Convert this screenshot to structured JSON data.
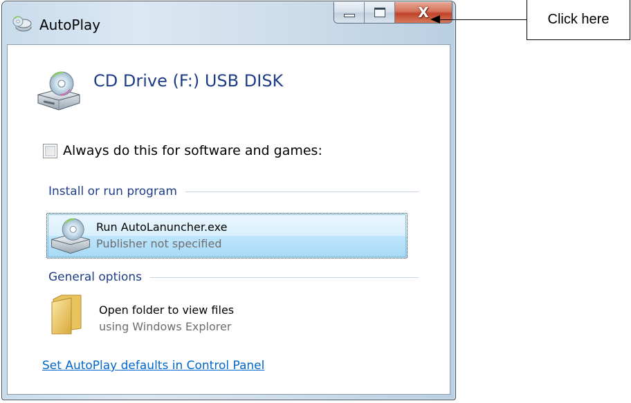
{
  "window": {
    "title": "AutoPlay",
    "caption": {
      "minimize_icon": "minimize-icon",
      "maximize_icon": "maximize-icon",
      "close_glyph": "X"
    }
  },
  "device": {
    "title": "CD Drive (F:) USB DISK",
    "icon": "cd-drive-icon"
  },
  "always_checkbox": {
    "label": "Always do this for software and games:",
    "checked": false
  },
  "sections": [
    {
      "header": "Install or run program",
      "options": [
        {
          "title": "Run AutoLanuncher.exe",
          "subtitle": "Publisher not specified",
          "icon": "cd-drive-icon",
          "selected": true
        }
      ]
    },
    {
      "header": "General options",
      "options": [
        {
          "title": "Open folder to view files",
          "subtitle": "using Windows Explorer",
          "icon": "folder-icon",
          "selected": false
        }
      ]
    }
  ],
  "control_panel_link": "Set AutoPlay defaults in Control Panel",
  "annotation": {
    "label": "Click here"
  },
  "colors": {
    "heading_blue": "#1e3d87",
    "link_blue": "#0066cc",
    "close_red": "#c0432a"
  }
}
